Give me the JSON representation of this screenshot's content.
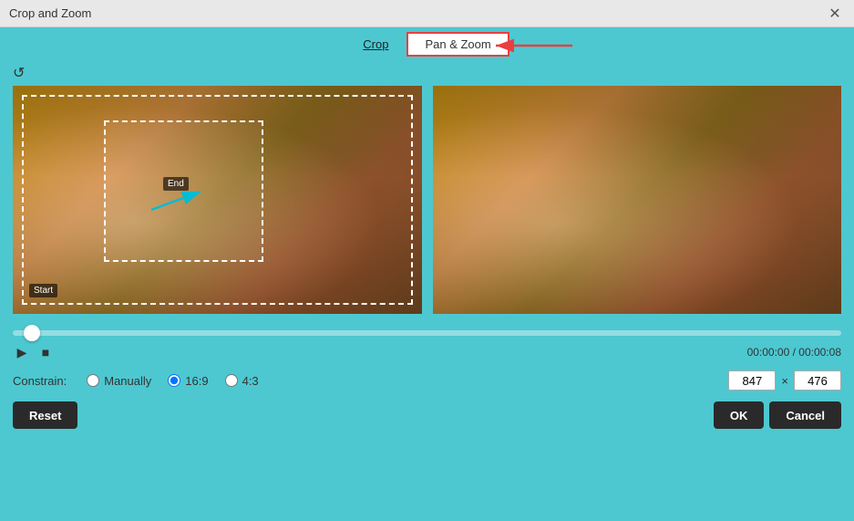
{
  "window": {
    "title": "Crop and Zoom",
    "close_label": "✕"
  },
  "tabs": {
    "crop_label": "Crop",
    "pan_zoom_label": "Pan & Zoom"
  },
  "toolbar": {
    "loop_icon": "↺"
  },
  "preview": {
    "left_label": "Start",
    "end_label": "End"
  },
  "timeline": {
    "time_display": "00:00:00 / 00:00:08"
  },
  "playback": {
    "play_icon": "▶",
    "stop_icon": "■"
  },
  "constrain": {
    "label": "Constrain:",
    "manually_label": "Manually",
    "ratio_16_9_label": "16:9",
    "ratio_4_3_label": "4:3",
    "width_value": "847",
    "height_value": "476",
    "x_separator": "×"
  },
  "buttons": {
    "reset_label": "Reset",
    "ok_label": "OK",
    "cancel_label": "Cancel"
  },
  "colors": {
    "background": "#4dc8d0",
    "title_bar": "#e8e8e8",
    "btn_dark": "#2a2a2a",
    "tab_highlight_border": "#e84040"
  }
}
